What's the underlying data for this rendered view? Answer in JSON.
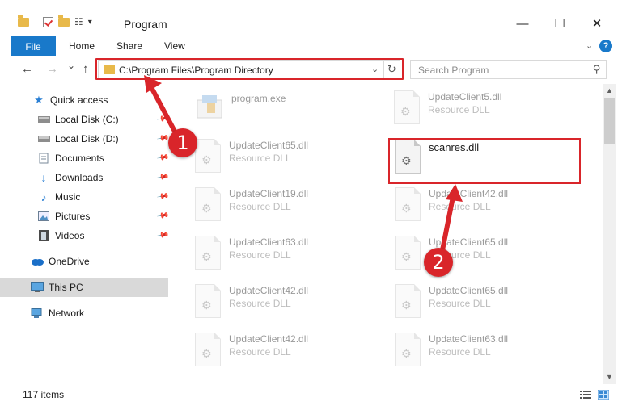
{
  "window": {
    "title": "Program",
    "minimize_glyph": "—",
    "maximize_glyph": "☐",
    "close_glyph": "✕"
  },
  "ribbon": {
    "file": "File",
    "home": "Home",
    "share": "Share",
    "view": "View",
    "help_glyph": "?"
  },
  "nav": {
    "back_glyph": "←",
    "forward_glyph": "→",
    "recent_glyph": "⌄",
    "up_glyph": "↑",
    "address": "C:\\Program Files\\Program Directory",
    "dropdown_glyph": "⌄",
    "refresh_glyph": "↻",
    "search_placeholder": "Search Program",
    "search_glyph": "⚲"
  },
  "sidebar": {
    "items": [
      {
        "label": "Quick access",
        "icon": "star-icon"
      },
      {
        "label": "Local Disk (C:)",
        "icon": "drive-icon",
        "pinned": true
      },
      {
        "label": "Local Disk (D:)",
        "icon": "drive-icon",
        "pinned": true
      },
      {
        "label": "Documents",
        "icon": "documents-icon",
        "pinned": true
      },
      {
        "label": "Downloads",
        "icon": "download-icon",
        "pinned": true
      },
      {
        "label": "Music",
        "icon": "music-icon",
        "pinned": true
      },
      {
        "label": "Pictures",
        "icon": "pictures-icon",
        "pinned": true
      },
      {
        "label": "Videos",
        "icon": "videos-icon",
        "pinned": true
      },
      {
        "label": "OneDrive",
        "icon": "cloud-icon"
      },
      {
        "label": "This PC",
        "icon": "computer-icon"
      },
      {
        "label": "Network",
        "icon": "network-icon"
      }
    ]
  },
  "files": [
    {
      "name": "program.exe",
      "type": ""
    },
    {
      "name": "UpdateClient5.dll",
      "type": "Resource DLL"
    },
    {
      "name": "UpdateClient65.dll",
      "type": "Resource DLL"
    },
    {
      "name": "scanres.dll",
      "type": ""
    },
    {
      "name": "UpdateClient19.dll",
      "type": "Resource DLL"
    },
    {
      "name": "UpdateClient42.dll",
      "type": "Resource DLL"
    },
    {
      "name": "UpdateClient63.dll",
      "type": "Resource DLL"
    },
    {
      "name": "UpdateClient65.dll",
      "type": "Resource DLL"
    },
    {
      "name": "UpdateClient42.dll",
      "type": "Resource DLL"
    },
    {
      "name": "UpdateClient65.dll",
      "type": "Resource DLL"
    },
    {
      "name": "UpdateClient42.dll",
      "type": "Resource DLL"
    },
    {
      "name": "UpdateClient63.dll",
      "type": "Resource DLL"
    }
  ],
  "status": {
    "count": "117 items"
  },
  "annotations": {
    "step1": "1",
    "step2": "2",
    "color": "#d9252a"
  },
  "colors": {
    "accent": "#1979ca",
    "folder": "#e8b94a"
  }
}
